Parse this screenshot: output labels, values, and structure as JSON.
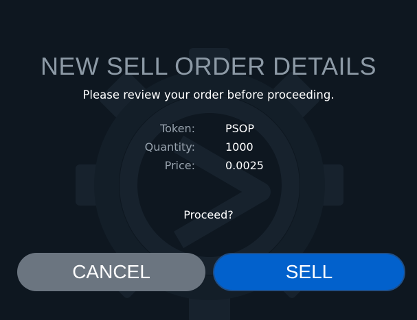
{
  "dialog": {
    "title": "NEW SELL ORDER DETAILS",
    "subtitle": "Please review your order before proceeding.",
    "details": [
      {
        "label": "Token:",
        "value": "PSOP"
      },
      {
        "label": "Quantity:",
        "value": "1000"
      },
      {
        "label": "Price:",
        "value": "0.0025"
      }
    ],
    "prompt": "Proceed?",
    "buttons": {
      "cancel_label": "CANCEL",
      "sell_label": "SELL"
    },
    "watermark_icon": "gear-play-logo-icon"
  },
  "colors": {
    "background": "#0e1720",
    "title": "#8d9aa6",
    "cancel_button": "#6b7580",
    "sell_button": "#0261cc"
  }
}
